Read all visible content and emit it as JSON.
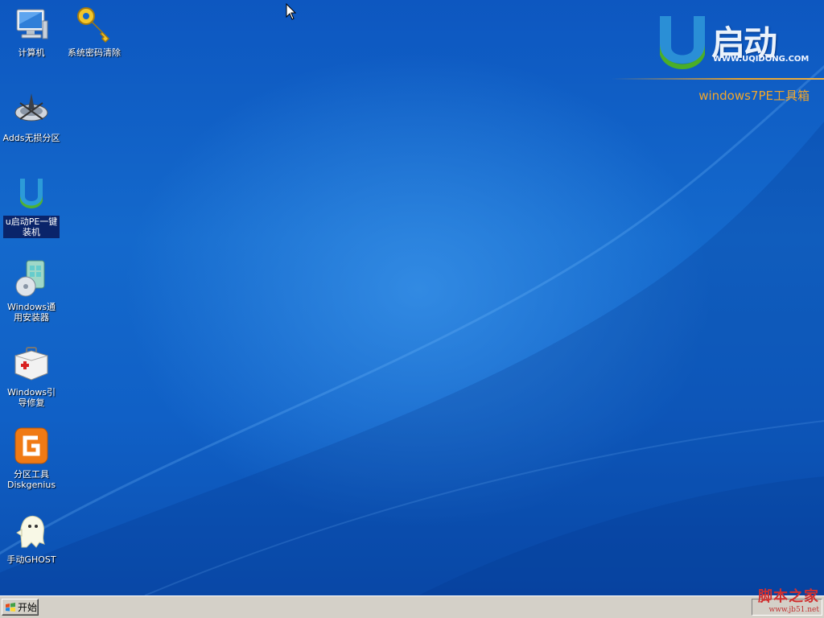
{
  "desktop": {
    "icons": [
      {
        "label": "计算机",
        "icon": "computer-icon"
      },
      {
        "label": "系统密码清除",
        "icon": "key-icon"
      },
      {
        "label": "Adds无损分区",
        "icon": "partition-tool-icon"
      },
      {
        "label": "u启动PE一键装机",
        "icon": "uqidong-logo-icon"
      },
      {
        "label": "Windows通用安装器",
        "icon": "installer-disc-icon"
      },
      {
        "label": "Windows引导修复",
        "icon": "first-aid-kit-icon"
      },
      {
        "label": "分区工具Diskgenius",
        "icon": "diskgenius-icon"
      },
      {
        "label": "手动GHOST",
        "icon": "ghost-icon"
      }
    ]
  },
  "brand": {
    "logo_letter": "U",
    "wordmark": "启动",
    "url": "WWW.UQIDONG.COM",
    "subtitle": "windows7PE工具箱"
  },
  "taskbar": {
    "start_label": "开始"
  },
  "watermark": {
    "text": "脚本之家",
    "site": "www.jb51.net"
  },
  "colors": {
    "desktop_blue": "#1166cc",
    "brand_orange": "#f2a62a",
    "taskbar_gray": "#d4d0c8",
    "selection_blue": "#0a246a"
  }
}
